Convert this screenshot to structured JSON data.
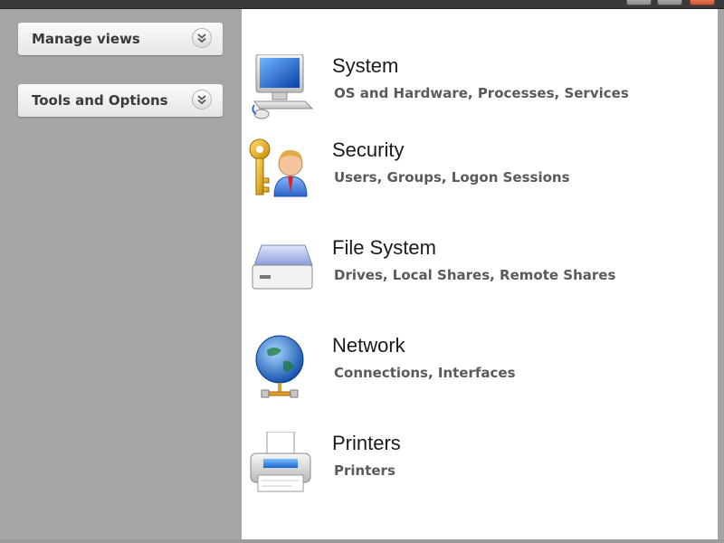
{
  "sidebar": {
    "panels": [
      {
        "label": "Manage views"
      },
      {
        "label": "Tools and Options"
      }
    ]
  },
  "categories": [
    {
      "title": "System",
      "subtitle": "OS and Hardware, Processes, Services",
      "icon": "computer-icon"
    },
    {
      "title": "Security",
      "subtitle": "Users, Groups, Logon Sessions",
      "icon": "key-user-icon"
    },
    {
      "title": "File System",
      "subtitle": "Drives, Local Shares, Remote Shares",
      "icon": "drive-icon"
    },
    {
      "title": "Network",
      "subtitle": "Connections, Interfaces",
      "icon": "globe-network-icon"
    },
    {
      "title": "Printers",
      "subtitle": "Printers",
      "icon": "printer-icon"
    }
  ],
  "colors": {
    "sidebar_bg": "#a5a5a5",
    "content_bg": "#ffffff",
    "close_button": "#d4593a"
  }
}
